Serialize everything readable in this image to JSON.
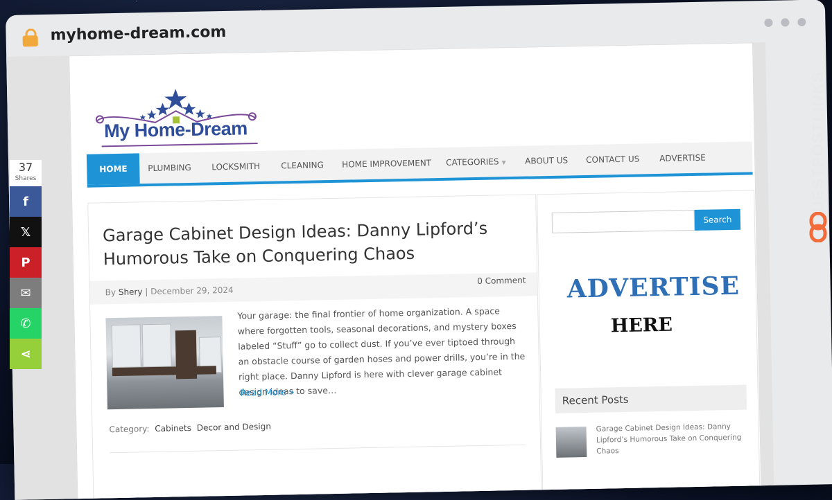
{
  "browser": {
    "url": "myhome-dream.com"
  },
  "site": {
    "logo_text": "My Home-Dream",
    "nav": [
      {
        "label": "HOME",
        "active": true
      },
      {
        "label": "PLUMBING"
      },
      {
        "label": "LOCKSMITH"
      },
      {
        "label": "CLEANING"
      },
      {
        "label": "HOME IMPROVEMENT"
      },
      {
        "label": "CATEGORIES",
        "dropdown": true
      },
      {
        "label": "ABOUT US"
      },
      {
        "label": "CONTACT US"
      },
      {
        "label": "ADVERTISE"
      }
    ]
  },
  "article": {
    "title": "Garage Cabinet Design Ideas: Danny Lipford’s Humorous Take on Conquering Chaos",
    "by": "By",
    "author": "Shery",
    "date": "December 29, 2024",
    "comments": "0 Comment",
    "excerpt": "Your garage: the final frontier of home organization. A space where forgotten tools, seasonal decorations, and mystery boxes labeled “Stuff” go to collect dust. If you’ve ever tiptoed through an obstacle course of garden hoses and power drills, you’re in the right place. Danny Lipford is here with clever garage cabinet design ideas to save…",
    "read_more": "Read More »",
    "category_label": "Category:",
    "categories": [
      "Cabinets",
      "Decor and Design"
    ]
  },
  "sidebar": {
    "search_button": "Search",
    "search_placeholder": "",
    "ad_line1": "ADVERTISE",
    "ad_line2": "HERE",
    "recent_heading": "Recent Posts",
    "recent_item": "Garage Cabinet Design Ideas: Danny Lipford’s Humorous Take on Conquering Chaos"
  },
  "share": {
    "count": "37",
    "label": "Shares",
    "buttons": [
      {
        "name": "facebook",
        "glyph": "f",
        "color": "#3b5998"
      },
      {
        "name": "x",
        "glyph": "𝕏",
        "color": "#111111"
      },
      {
        "name": "pinterest",
        "glyph": "P",
        "color": "#cb2027"
      },
      {
        "name": "email",
        "glyph": "✉",
        "color": "#7d7d7d"
      },
      {
        "name": "whatsapp",
        "glyph": "✆",
        "color": "#25d366"
      },
      {
        "name": "share",
        "glyph": "⋖",
        "color": "#95d03a"
      }
    ]
  },
  "brand": {
    "text": "GUESTPOSTLINKS",
    "accent": "#f26b3a"
  }
}
